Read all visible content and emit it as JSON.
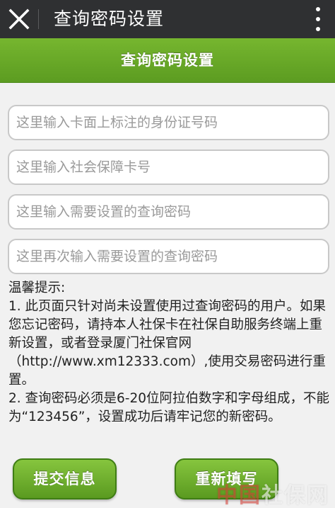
{
  "titlebar": {
    "title": "查询密码设置",
    "close_icon": "close-icon",
    "more_icon": "more-vertical-icon"
  },
  "header": {
    "title": "查询密码设置"
  },
  "form": {
    "id_card_placeholder": "这里输入卡面上标注的身份证号码",
    "ss_card_placeholder": "这里输入社会保障卡号",
    "password_placeholder": "这里输入需要设置的查询密码",
    "password_confirm_placeholder": "这里再次输入需要设置的查询密码"
  },
  "tips": {
    "heading": "温馨提示:",
    "item1": "1. 此页面只针对尚未设置使用过查询密码的用户。如果您忘记密码，请持本人社保卡在社保自助服务终端上重新设置，或者登录厦门社保官网（http://www.xm12333.com）,使用交易密码进行重置。",
    "item2": "2. 查询密码必须是6-20位阿拉伯数字和字母组成，不能为“123456”，设置成功后请牢记您的新密码。"
  },
  "buttons": {
    "submit_label": "提交信息",
    "reset_label": "重新填写"
  },
  "watermark": {
    "prefix": "中国",
    "suffix": "社保网"
  },
  "colors": {
    "titlebar": "#2f3032",
    "header_green": "#6aab28",
    "button_green": "#5a9a20",
    "page_background": "#f1f1f1"
  }
}
